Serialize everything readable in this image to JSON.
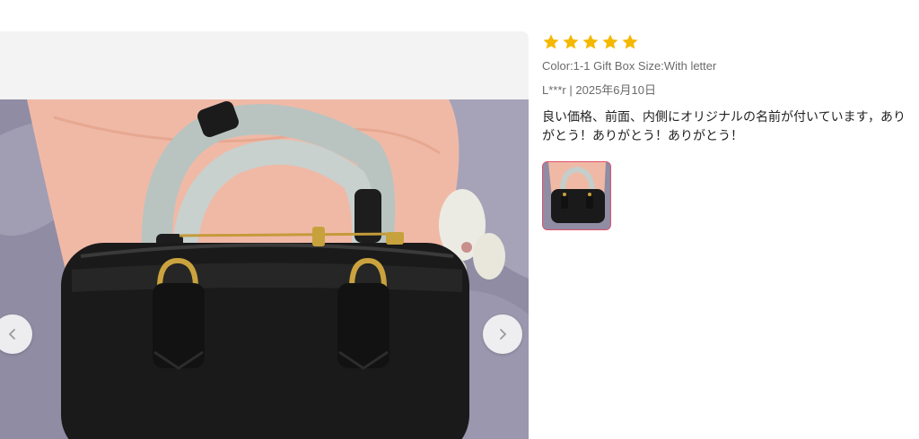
{
  "review": {
    "rating": 5,
    "rating_max": 5,
    "star_color": "#f5b800",
    "variant": "Color:1-1 Gift Box Size:With letter",
    "author": "L***r",
    "separator": "|",
    "date": "2025年6月10日",
    "text": "良い価格、前面、内側にオリジナルの名前が付いています，ありがとう！ありがとう！ありがとう！"
  },
  "gallery": {
    "prev_icon": "chevron-left-icon",
    "next_icon": "chevron-right-icon",
    "thumb_count": 1,
    "selected_thumb_border": "#e0506a"
  }
}
